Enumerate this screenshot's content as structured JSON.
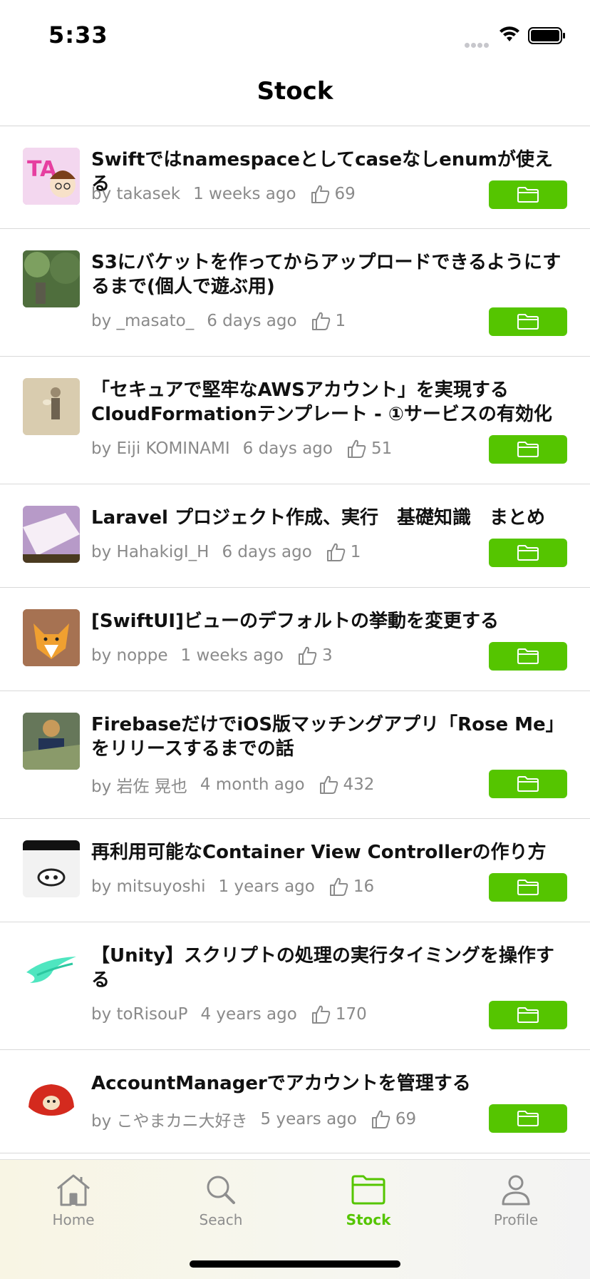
{
  "status": {
    "time": "5:33"
  },
  "nav": {
    "title": "Stock"
  },
  "items": [
    {
      "title": "Swiftではnamespaceとしてcaseなしenumが使える",
      "author": "by takasek",
      "age": "1 weeks ago",
      "likes": "69"
    },
    {
      "title": "S3にバケットを作ってからアップロードできるようにするまで(個人で遊ぶ用)",
      "author": "by _masato_",
      "age": "6 days ago",
      "likes": "1"
    },
    {
      "title": "「セキュアで堅牢なAWSアカウント」を実現するCloudFormationテンプレート - ①サービスの有効化",
      "author": "by Eiji KOMINAMI",
      "age": "6 days ago",
      "likes": "51"
    },
    {
      "title": "Laravel プロジェクト作成、実行　基礎知識　まとめ",
      "author": "by HahakigI_H",
      "age": "6 days ago",
      "likes": "1"
    },
    {
      "title": "[SwiftUI]ビューのデフォルトの挙動を変更する",
      "author": "by noppe",
      "age": "1 weeks ago",
      "likes": "3"
    },
    {
      "title": "FirebaseだけでiOS版マッチングアプリ「Rose Me」をリリースするまでの話",
      "author": "by 岩佐 晃也",
      "age": "4 month ago",
      "likes": "432"
    },
    {
      "title": "再利用可能なContainer View Controllerの作り方",
      "author": "by mitsuyoshi",
      "age": "1 years ago",
      "likes": "16"
    },
    {
      "title": "【Unity】スクリプトの処理の実行タイミングを操作する",
      "author": "by toRisouP",
      "age": "4 years ago",
      "likes": "170"
    },
    {
      "title": "AccountManagerでアカウントを管理する",
      "author": "by こやまカニ大好き",
      "age": "5 years ago",
      "likes": "69"
    }
  ],
  "tabs": {
    "home": "Home",
    "search": "Seach",
    "stock": "Stock",
    "profile": "Profile"
  },
  "colors": {
    "accent": "#55c500",
    "tab_inactive": "#8e8e8e"
  }
}
